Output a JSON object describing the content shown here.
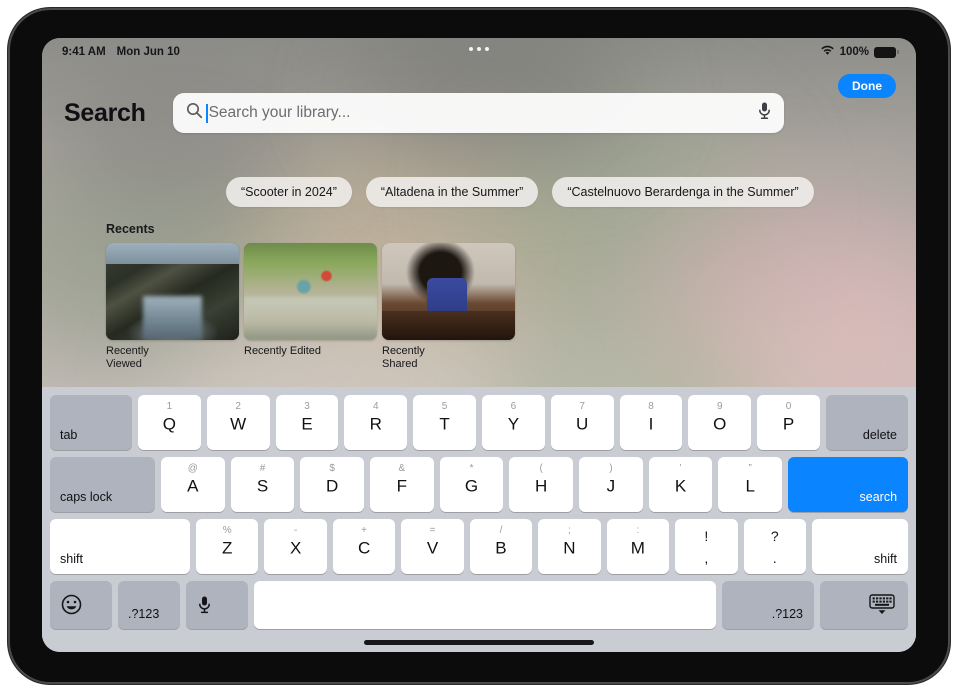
{
  "status_bar": {
    "time": "9:41 AM",
    "date": "Mon Jun 10",
    "battery_percent": "100%",
    "wifi_icon": "wifi-icon",
    "battery_icon": "battery-icon",
    "multitask_icon": "multitasking-dots-icon"
  },
  "header": {
    "done_label": "Done",
    "page_title": "Search"
  },
  "search": {
    "placeholder": "Search your library...",
    "value": "",
    "search_icon": "search-icon",
    "mic_icon": "microphone-icon"
  },
  "suggestions": [
    {
      "label": "“Scooter in 2024”"
    },
    {
      "label": "“Altadena in the Summer”"
    },
    {
      "label": "“Castelnuovo Berardenga in the Summer”"
    }
  ],
  "recents": {
    "heading": "Recents",
    "items": [
      {
        "label": "Recently Viewed",
        "art": "thumb-cliffs"
      },
      {
        "label": "Recently Edited",
        "art": "thumb-creek"
      },
      {
        "label": "Recently Shared",
        "art": "thumb-chess"
      }
    ]
  },
  "keyboard": {
    "accent_color": "#0b84ff",
    "modifier_color": "#aeb3bd",
    "key_color": "#ffffff",
    "background_color": "#c9ccd2",
    "row1": {
      "tab": "tab",
      "delete": "delete",
      "keys": [
        {
          "main": "Q",
          "alt": "1"
        },
        {
          "main": "W",
          "alt": "2"
        },
        {
          "main": "E",
          "alt": "3"
        },
        {
          "main": "R",
          "alt": "4"
        },
        {
          "main": "T",
          "alt": "5"
        },
        {
          "main": "Y",
          "alt": "6"
        },
        {
          "main": "U",
          "alt": "7"
        },
        {
          "main": "I",
          "alt": "8"
        },
        {
          "main": "O",
          "alt": "9"
        },
        {
          "main": "P",
          "alt": "0"
        }
      ]
    },
    "row2": {
      "caps_lock": "caps lock",
      "search": "search",
      "keys": [
        {
          "main": "A",
          "alt": "@"
        },
        {
          "main": "S",
          "alt": "#"
        },
        {
          "main": "D",
          "alt": "$"
        },
        {
          "main": "F",
          "alt": "&"
        },
        {
          "main": "G",
          "alt": "*"
        },
        {
          "main": "H",
          "alt": "("
        },
        {
          "main": "J",
          "alt": ")"
        },
        {
          "main": "K",
          "alt": "’"
        },
        {
          "main": "L",
          "alt": "”"
        }
      ]
    },
    "row3": {
      "shift_left": "shift",
      "shift_right": "shift",
      "keys": [
        {
          "main": "Z",
          "alt": "%"
        },
        {
          "main": "X",
          "alt": "-"
        },
        {
          "main": "C",
          "alt": "+"
        },
        {
          "main": "V",
          "alt": "="
        },
        {
          "main": "B",
          "alt": "/"
        },
        {
          "main": "N",
          "alt": ";"
        },
        {
          "main": "M",
          "alt": ":"
        }
      ],
      "punct": [
        {
          "top": "!",
          "bottom": ","
        },
        {
          "top": "?",
          "bottom": "."
        }
      ]
    },
    "row4": {
      "emoji_icon": "emoji-smiley-icon",
      "numbers_left": ".?123",
      "mic_icon": "microphone-icon",
      "space": "",
      "numbers_right": ".?123",
      "dismiss_icon": "dismiss-keyboard-icon"
    }
  }
}
